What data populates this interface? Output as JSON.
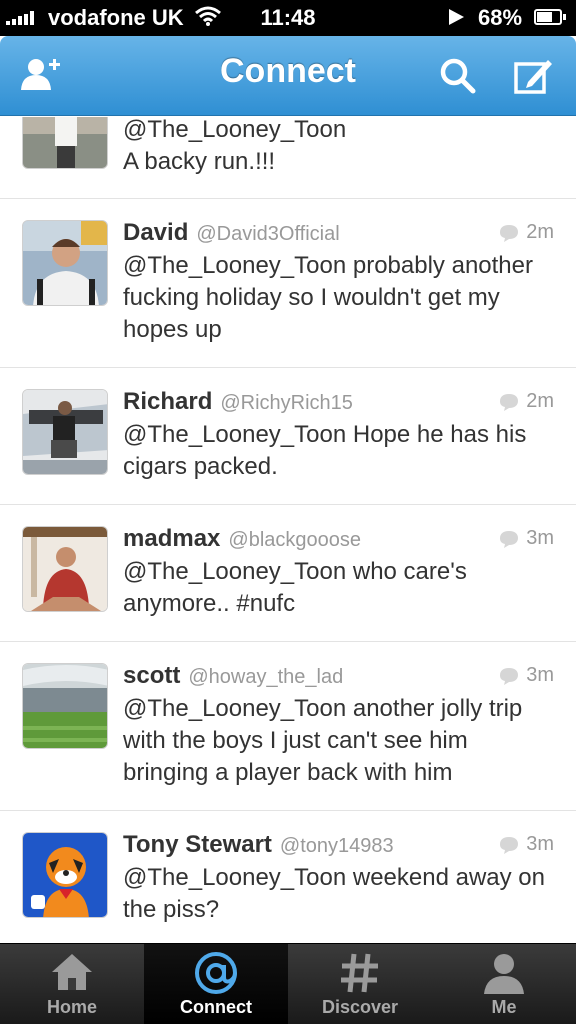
{
  "status_bar": {
    "carrier": "vodafone UK",
    "time": "11:48",
    "battery": "68%",
    "battery_level": 0.68
  },
  "nav": {
    "title": "Connect",
    "left_icon": "add-user-icon",
    "right_icons": [
      "search-icon",
      "compose-icon"
    ],
    "accent": "#3b9ad9"
  },
  "tweets": [
    {
      "name": "",
      "handle": "",
      "time": "",
      "text": "@The_Looney_Toon\nA backy run.!!!"
    },
    {
      "name": "David",
      "handle": "@David3Official",
      "time": "2m",
      "text": "@The_Looney_Toon probably another fucking holiday so I wouldn't get my hopes up"
    },
    {
      "name": "Richard",
      "handle": "@RichyRich15",
      "time": "2m",
      "text": "@The_Looney_Toon Hope he has his cigars packed."
    },
    {
      "name": "madmax",
      "handle": "@blackgooose",
      "time": "3m",
      "text": "@The_Looney_Toon who care's anymore..  #nufc"
    },
    {
      "name": "scott",
      "handle": "@howay_the_lad",
      "time": "3m",
      "text": "@The_Looney_Toon another jolly trip with the boys I just can't see him bringing a player back with him"
    },
    {
      "name": "Tony Stewart",
      "handle": "@tony14983",
      "time": "3m",
      "text": "@The_Looney_Toon weekend away on the piss?"
    }
  ],
  "tab_bar": {
    "tabs": [
      {
        "label": "Home",
        "icon": "home-icon"
      },
      {
        "label": "Connect",
        "icon": "at-sign-icon",
        "active": true
      },
      {
        "label": "Discover",
        "icon": "hashtag-icon"
      },
      {
        "label": "Me",
        "icon": "profile-icon"
      }
    ]
  }
}
